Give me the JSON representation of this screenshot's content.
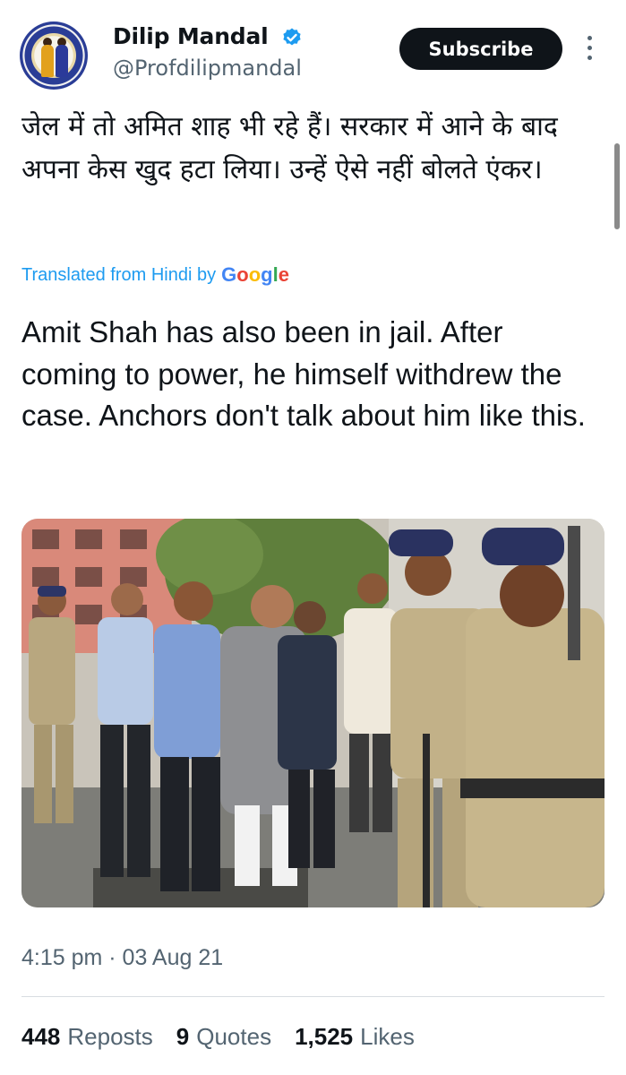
{
  "author": {
    "name": "Dilip Mandal",
    "handle": "@Profdilipmandal",
    "verified": true
  },
  "actions": {
    "subscribe_label": "Subscribe",
    "more_icon": "more-vertical-icon"
  },
  "tweet": {
    "text_hindi": "जेल में तो अमित शाह भी रहे हैं। सरकार में आने के बाद अपना केस खुद हटा लिया। उन्हें ऐसे नहीं बोलते एंकर।",
    "translated_label": "Translated from Hindi by",
    "translator": "Google",
    "text_english": "Amit Shah has also been in jail. After coming to power, he himself withdrew the case. Anchors don't talk about him like this.",
    "timestamp": "4:15 pm · 03 Aug 21"
  },
  "stats": {
    "reposts_count": "448",
    "reposts_label": "Reposts",
    "quotes_count": "9",
    "quotes_label": "Quotes",
    "likes_count": "1,525",
    "likes_label": "Likes"
  },
  "colors": {
    "accent": "#1d9bf0",
    "text": "#0f1419",
    "secondary": "#536471",
    "button_bg": "#0f1419"
  }
}
